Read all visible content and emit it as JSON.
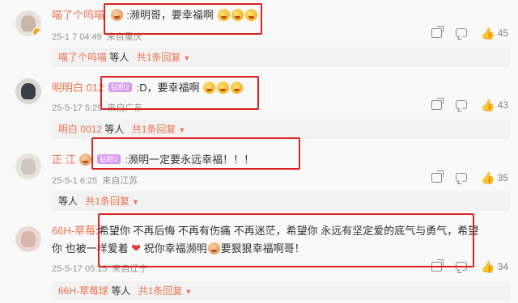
{
  "comments": [
    {
      "username": "喵了个呜喵",
      "text_before": ":濒明哥，要幸福啊",
      "emoji_count": 3,
      "time": "25-1 7 04:49",
      "source": "来自重庆",
      "reply_user": "喵了个呜喵",
      "reply_suffix": "等人",
      "reply_count": "共1条回复",
      "likes": "45"
    },
    {
      "username": "明明白 012",
      "medal": "钻粉2",
      "text": ":D，要幸福啊",
      "time": "25-5-17 5:29",
      "source": "来自广东",
      "reply_user": "明白 0012",
      "reply_suffix": "等人",
      "reply_count": "共1条回复",
      "likes": "43"
    },
    {
      "username": "正 江 ",
      "medal": "钻粉2",
      "text": ":濒明一定要永远幸福！！！",
      "time": "25-5-1 6:25",
      "source": "来自江苏",
      "reply_user": "  ",
      "reply_suffix": "等人",
      "reply_count": "共1条回复",
      "likes": "35"
    },
    {
      "username": "66H-草莓",
      "text_line1": ":希望你 不再后悔 不再有伤痛 不再迷茫，希望你 永远有坚定爱的底气与勇气，希望",
      "text_line2a": "你 也被一样爱着",
      "text_line2b": "祝你幸福濒明",
      "text_line2c": "要狠狠幸福啊哥！",
      "time": "25-5-17 05:15",
      "source": "来自辽宁",
      "reply_user": "66H-草莓球",
      "reply_suffix": "等人",
      "reply_count": "共1条回复",
      "likes": "34"
    }
  ],
  "icons": {
    "share": "share-icon",
    "comment": "comment-icon",
    "like": "thumbs-up-icon",
    "caret": "caret-down-icon"
  },
  "colors": {
    "username": "#eb7350",
    "highlight_box": "#d9231e",
    "reply_bg": "#f2f2f2",
    "meta": "#939393"
  }
}
